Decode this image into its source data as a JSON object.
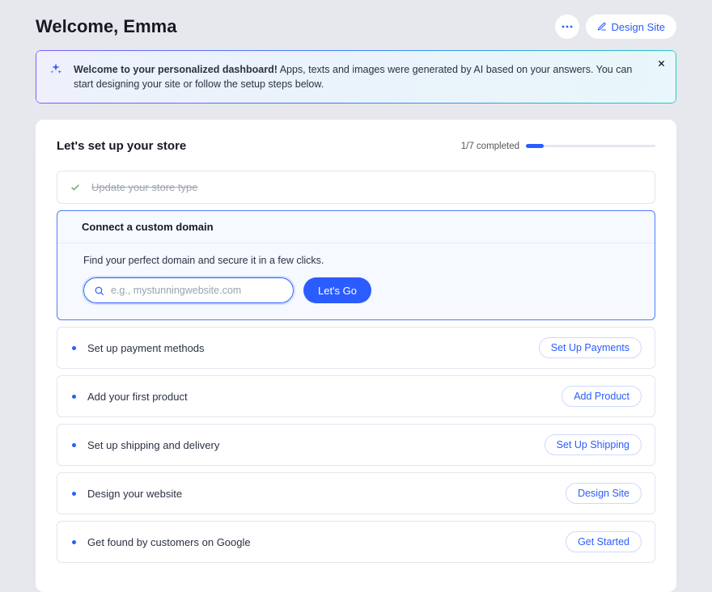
{
  "header": {
    "title": "Welcome, Emma",
    "design_site_label": "Design Site"
  },
  "banner": {
    "bold": "Welcome to your personalized dashboard!",
    "rest": " Apps, texts and images were generated by AI based on your answers. You can start designing your site or follow the setup steps below."
  },
  "setup": {
    "title": "Let's set up your store",
    "progress_label": "1/7 completed",
    "progress_percent": 14,
    "completed_step": {
      "label": "Update your store type"
    },
    "expanded_step": {
      "title": "Connect a custom domain",
      "description": "Find your perfect domain and secure it in a few clicks.",
      "placeholder": "e.g., mystunningwebsite.com",
      "button_label": "Let's Go"
    },
    "steps": [
      {
        "label": "Set up payment methods",
        "action": "Set Up Payments"
      },
      {
        "label": "Add your first product",
        "action": "Add Product"
      },
      {
        "label": "Set up shipping and delivery",
        "action": "Set Up Shipping"
      },
      {
        "label": "Design your website",
        "action": "Design Site"
      },
      {
        "label": "Get found by customers on Google",
        "action": "Get Started"
      }
    ]
  }
}
